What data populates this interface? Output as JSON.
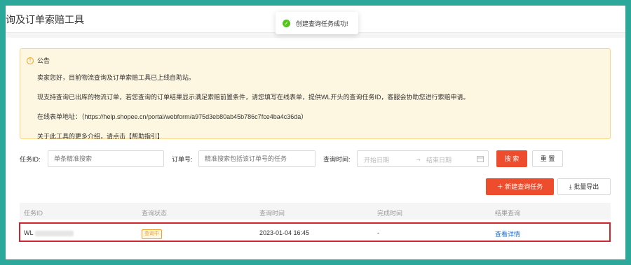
{
  "header": {
    "title": "询及订单索赔工具"
  },
  "toast": {
    "message": "创建查询任务成功!",
    "icon": "check-circle-icon"
  },
  "notice": {
    "heading": "公告",
    "lines": [
      "卖家您好，目前物流查询及订单索赔工具已上线自助站。",
      "现支持查询已出库的物流订单，若您查询的订单结果显示满足索赔前置条件，请您填写在线表单，提供WL开头的查询任务ID，客服会协助您进行索赔申请。",
      "在线表单地址：（https://help.shopee.cn/portal/webform/a975d3eb80ab45b786c7fce4ba4c36da）",
      "关于此工具的更多介绍，请点击【帮助指引】"
    ]
  },
  "filters": {
    "task_id_label": "任务ID:",
    "task_id_placeholder": "单条精准搜索",
    "order_label": "订单号:",
    "order_placeholder": "精准搜索包括该订单号的任务",
    "time_label": "查询时间:",
    "start_placeholder": "开始日期",
    "arrow": "→",
    "end_placeholder": "结束日期",
    "search_label": "搜 索",
    "reset_label": "重 置"
  },
  "actions": {
    "new_task_label": "新建查询任务",
    "export_label": "批量导出"
  },
  "table": {
    "columns": [
      "任务ID",
      "查询状态",
      "查询时间",
      "完成时间",
      "结果查询"
    ],
    "rows": [
      {
        "task_id_prefix": "WL",
        "status": "查询中",
        "query_time": "2023-01-04 16:45",
        "complete_time": "-",
        "result_link": "查看详情"
      }
    ]
  },
  "colors": {
    "accent": "#ee4d2d",
    "success": "#52c41a",
    "warning": "#f0a020",
    "link": "#1f6fd1",
    "highlight_border": "#d0252f",
    "frame_background": "#2ba89a"
  }
}
